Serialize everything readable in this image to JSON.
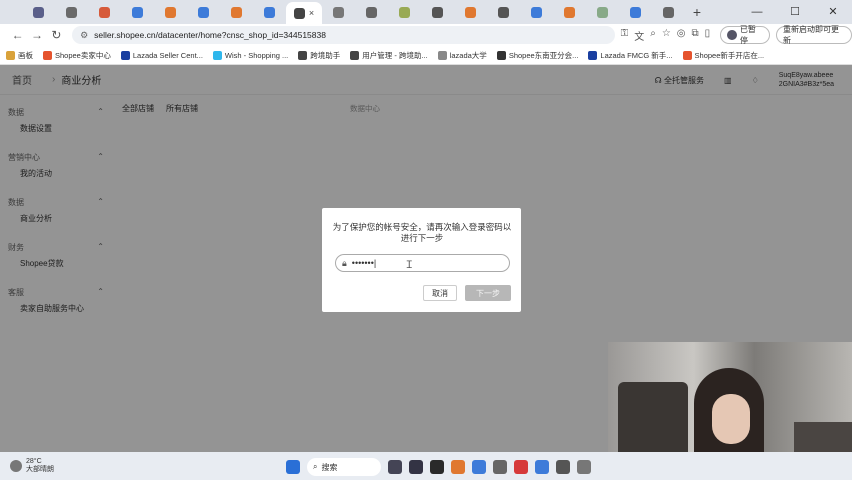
{
  "browser": {
    "tabs": [
      {
        "color": "#5a5f8a"
      },
      {
        "color": "#6a6a6a"
      },
      {
        "color": "#d65a3a"
      },
      {
        "color": "#3d7bd9"
      },
      {
        "color": "#e07830"
      },
      {
        "color": "#3d7bd9"
      },
      {
        "color": "#e07830"
      },
      {
        "color": "#3d7bd9"
      },
      {
        "color": "#444"
      },
      {
        "color": "#777"
      },
      {
        "color": "#666"
      },
      {
        "color": "#9a5"
      },
      {
        "color": "#555"
      },
      {
        "color": "#e07830"
      },
      {
        "color": "#555"
      },
      {
        "color": "#3d7bd9"
      },
      {
        "color": "#e07830"
      },
      {
        "color": "#8a8"
      },
      {
        "color": "#3d7bd9"
      },
      {
        "color": "#666"
      }
    ],
    "active_tab_close": "×",
    "new_tab": "+",
    "url": "seller.shopee.cn/datacenter/home?cnsc_shop_id=344515838",
    "pause_label": "已暂停",
    "update_label": "重新启动即可更新"
  },
  "bookmarks": [
    {
      "label": "画板",
      "color": "#d9a23a"
    },
    {
      "label": "Shopee卖家中心",
      "color": "#e5532d"
    },
    {
      "label": "Lazada Seller Cent...",
      "color": "#1a3fa0"
    },
    {
      "label": "Wish - Shopping ...",
      "color": "#2fb7ec"
    },
    {
      "label": "跨境助手",
      "color": "#444"
    },
    {
      "label": "用户管理 - 跨境助...",
      "color": "#444"
    },
    {
      "label": "lazada大学",
      "color": "#888"
    },
    {
      "label": "Shopee东南亚分会...",
      "color": "#333"
    },
    {
      "label": "Lazada FMCG 新手...",
      "color": "#1a3fa0"
    },
    {
      "label": "Shopee新手开店在...",
      "color": "#e5532d"
    }
  ],
  "shopee": {
    "home": "首页",
    "title": "商业分析",
    "custody": "全托管服务",
    "account_name": "SuqE8yaw.abeee",
    "account_sub": "2GNIA3#B3z*5ea",
    "sidebar": [
      {
        "header": "数据",
        "item": "数据设置"
      },
      {
        "header": "营销中心",
        "item": "我的活动"
      },
      {
        "header": "数据",
        "item": "商业分析"
      },
      {
        "header": "财务",
        "item": "Shopee贷款"
      },
      {
        "header": "客服",
        "item": "卖家自助服务中心"
      }
    ],
    "tabs": [
      "全部店铺",
      "所有店铺"
    ],
    "crumb": "数据中心"
  },
  "modal": {
    "message": "为了保护您的帐号安全，请再次输入登录密码以进行下一步",
    "password_value": "•••••••|",
    "cancel": "取消",
    "next": "下一步"
  },
  "taskbar": {
    "temp": "28°C",
    "weather": "大部晴朗",
    "search": "搜索",
    "icons": [
      {
        "color": "#445"
      },
      {
        "color": "#334"
      },
      {
        "color": "#2a2a2a"
      },
      {
        "color": "#e07830"
      },
      {
        "color": "#3d7bd9"
      },
      {
        "color": "#666"
      },
      {
        "color": "#d63a3a"
      },
      {
        "color": "#3d7bd9"
      },
      {
        "color": "#555"
      },
      {
        "color": "#777"
      }
    ]
  }
}
